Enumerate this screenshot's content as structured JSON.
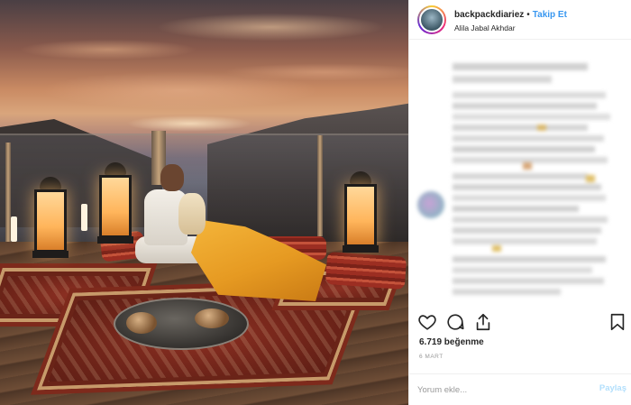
{
  "post": {
    "username": "backpackdiariez",
    "separator": "•",
    "follow_label": "Takip Et",
    "location": "Alila Jabal Akhdar",
    "likes_text": "6.719 beğenme",
    "date_text": "6 MART",
    "comment_placeholder": "Yorum ekle...",
    "post_button_label": "Paylaş"
  },
  "icons": {
    "like": "heart-icon",
    "comment": "comment-icon",
    "share": "share-icon",
    "save": "bookmark-icon"
  },
  "colors": {
    "follow": "#3897f0",
    "post_button_disabled": "#b2dffc",
    "muted_text": "#999999"
  }
}
